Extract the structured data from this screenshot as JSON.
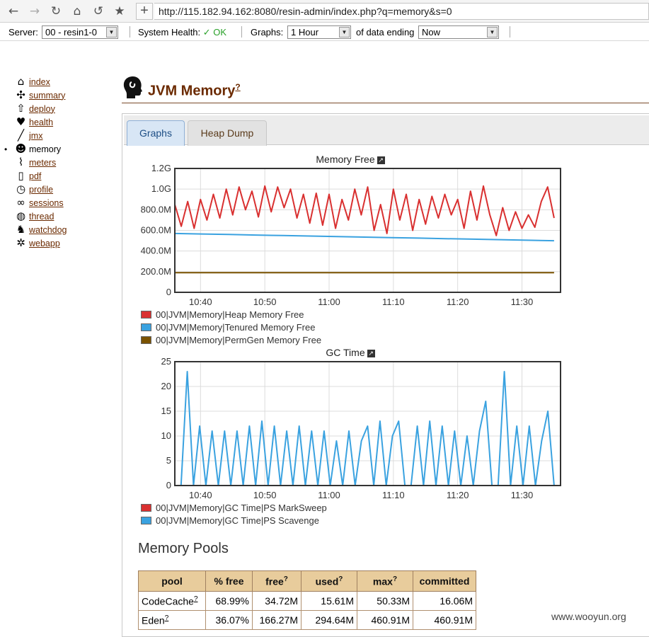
{
  "browser": {
    "url": "http://115.182.94.162:8080/resin-admin/index.php?q=memory&s=0"
  },
  "toolbar": {
    "server_label": "Server:",
    "server_value": "00 - resin1-0",
    "health_label": "System Health:",
    "health_status": "✓ OK",
    "graphs_label": "Graphs:",
    "graphs_value": "1 Hour",
    "ending_label": "of data ending",
    "ending_value": "Now"
  },
  "sidebar": {
    "items": [
      {
        "label": "index",
        "icon": "house-icon"
      },
      {
        "label": "summary",
        "icon": "windmill-icon"
      },
      {
        "label": "deploy",
        "icon": "upload-icon"
      },
      {
        "label": "health",
        "icon": "heart-icon"
      },
      {
        "label": "jmx",
        "icon": "wrench-icon"
      },
      {
        "label": "memory",
        "icon": "head-icon"
      },
      {
        "label": "meters",
        "icon": "line-graph-icon"
      },
      {
        "label": "pdf",
        "icon": "document-icon"
      },
      {
        "label": "profile",
        "icon": "stopwatch-icon"
      },
      {
        "label": "sessions",
        "icon": "chain-icon"
      },
      {
        "label": "thread",
        "icon": "spool-icon"
      },
      {
        "label": "watchdog",
        "icon": "dog-icon"
      },
      {
        "label": "webapp",
        "icon": "web-icon"
      }
    ],
    "current": "memory"
  },
  "page": {
    "title": "JVM Memory",
    "title_help": "?"
  },
  "tabs": {
    "graphs": "Graphs",
    "heap_dump": "Heap Dump"
  },
  "colors": {
    "heap": "#d93030",
    "tenured": "#3aa2e0",
    "permgen": "#7a5200",
    "marksweep": "#d93030",
    "scavenge": "#3aa2e0"
  },
  "chart_data": [
    {
      "type": "line",
      "title": "Memory Free",
      "x_ticks": [
        "10:40",
        "10:50",
        "11:00",
        "11:10",
        "11:20",
        "11:30"
      ],
      "y_ticks": [
        "0",
        "200.0M",
        "400.0M",
        "600.0M",
        "800.0M",
        "1.0G",
        "1.2G"
      ],
      "ylim": [
        0,
        1.2
      ],
      "y_unit": "G",
      "grid": true,
      "series": [
        {
          "name": "00|JVM|Memory|Heap Memory Free",
          "values": [
            0.85,
            0.64,
            0.88,
            0.62,
            0.9,
            0.7,
            0.95,
            0.72,
            1.0,
            0.75,
            1.02,
            0.8,
            0.98,
            0.73,
            1.03,
            0.78,
            1.02,
            0.82,
            1.0,
            0.72,
            0.95,
            0.67,
            0.96,
            0.65,
            0.95,
            0.62,
            0.9,
            0.7,
            1.0,
            0.75,
            1.02,
            0.6,
            0.85,
            0.57,
            1.0,
            0.7,
            0.95,
            0.6,
            0.9,
            0.66,
            0.93,
            0.72,
            0.95,
            0.75,
            0.9,
            0.62,
            0.98,
            0.7,
            1.03,
            0.75,
            0.55,
            0.82,
            0.6,
            0.78,
            0.62,
            0.75,
            0.63,
            0.88,
            1.02,
            0.72
          ]
        },
        {
          "name": "00|JVM|Memory|Tenured Memory Free",
          "values": [
            0.57,
            0.565,
            0.56,
            0.555,
            0.55,
            0.545,
            0.54,
            0.535,
            0.53,
            0.525,
            0.52,
            0.515,
            0.51,
            0.505,
            0.5
          ]
        },
        {
          "name": "00|JVM|Memory|PermGen Memory Free",
          "values": [
            0.19,
            0.19,
            0.19,
            0.19,
            0.19,
            0.19,
            0.19,
            0.19,
            0.19,
            0.19,
            0.19,
            0.19,
            0.19,
            0.19,
            0.19
          ]
        }
      ]
    },
    {
      "type": "line",
      "title": "GC Time",
      "x_ticks": [
        "10:40",
        "10:50",
        "11:00",
        "11:10",
        "11:20",
        "11:30"
      ],
      "y_ticks": [
        "0",
        "5",
        "10",
        "15",
        "20",
        "25"
      ],
      "ylim": [
        0,
        25
      ],
      "grid": true,
      "series": [
        {
          "name": "00|JVM|Memory|GC Time|PS MarkSweep",
          "values": [
            0,
            0,
            0,
            0,
            0,
            0,
            0,
            0,
            0,
            0,
            0,
            0,
            0,
            0,
            0
          ]
        },
        {
          "name": "00|JVM|Memory|GC Time|PS Scavenge",
          "values": [
            0,
            0,
            23,
            0,
            12,
            0,
            11,
            0,
            11,
            0,
            11,
            0,
            12,
            0,
            13,
            0,
            12,
            0,
            11,
            0,
            12,
            0,
            11,
            0,
            11,
            0,
            9,
            0,
            11,
            0,
            9,
            12,
            0,
            13,
            0,
            10,
            13,
            0,
            0,
            12,
            0,
            13,
            0,
            12,
            0,
            11,
            0,
            10,
            0,
            11,
            17,
            0,
            0,
            23,
            0,
            12,
            0,
            12,
            0,
            9,
            15,
            0
          ]
        }
      ]
    }
  ],
  "chart_xlim": [
    10.6,
    11.6
  ],
  "pools": {
    "title": "Memory Pools",
    "headers": [
      "pool",
      "% free",
      "free",
      "used",
      "max",
      "committed"
    ],
    "help": "?",
    "rows": [
      [
        "CodeCache",
        "68.99%",
        "34.72M",
        "15.61M",
        "50.33M",
        "16.06M"
      ],
      [
        "Eden",
        "36.07%",
        "166.27M",
        "294.64M",
        "460.91M",
        "460.91M"
      ]
    ]
  },
  "watermark": "www.wooyun.org"
}
